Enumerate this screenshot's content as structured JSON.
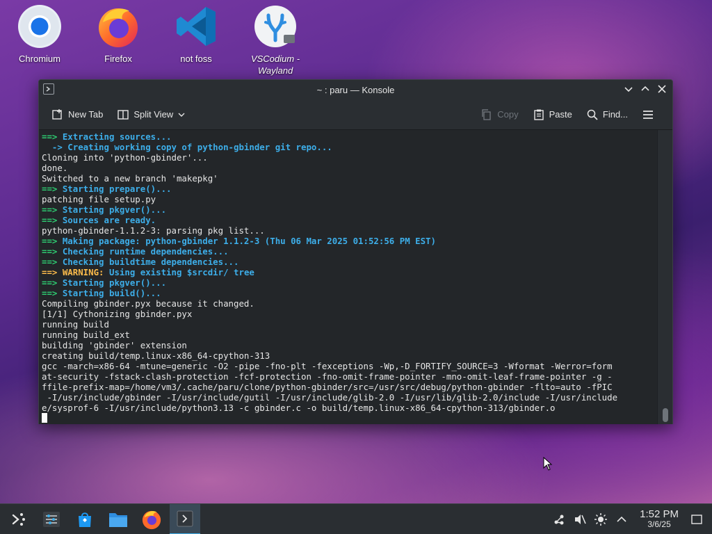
{
  "desktop": {
    "icons": [
      {
        "label": "Chromium"
      },
      {
        "label": "Firefox"
      },
      {
        "label": "not foss"
      },
      {
        "label": "VSCodium - Wayland"
      }
    ]
  },
  "window": {
    "title": "~ : paru — Konsole",
    "toolbar": {
      "new_tab": "New Tab",
      "split_view": "Split View",
      "copy": "Copy",
      "paste": "Paste",
      "find": "Find..."
    }
  },
  "terminal": {
    "lines": [
      [
        {
          "t": "==> ",
          "c": "c-green"
        },
        {
          "t": "Extracting sources...",
          "c": "c-blue"
        }
      ],
      [
        {
          "t": "  -> Creating working copy of python-gbinder git repo...",
          "c": "c-blue"
        }
      ],
      [
        {
          "t": "Cloning into 'python-gbinder'...",
          "c": ""
        }
      ],
      [
        {
          "t": "done.",
          "c": ""
        }
      ],
      [
        {
          "t": "Switched to a new branch 'makepkg'",
          "c": ""
        }
      ],
      [
        {
          "t": "==> ",
          "c": "c-green"
        },
        {
          "t": "Starting prepare()...",
          "c": "c-blue"
        }
      ],
      [
        {
          "t": "patching file setup.py",
          "c": ""
        }
      ],
      [
        {
          "t": "==> ",
          "c": "c-green"
        },
        {
          "t": "Starting pkgver()...",
          "c": "c-blue"
        }
      ],
      [
        {
          "t": "==> ",
          "c": "c-green"
        },
        {
          "t": "Sources are ready.",
          "c": "c-blue"
        }
      ],
      [
        {
          "t": "python-gbinder-1.1.2-3: parsing pkg list...",
          "c": ""
        }
      ],
      [
        {
          "t": "==> ",
          "c": "c-green"
        },
        {
          "t": "Making package: python-gbinder 1.1.2-3 (Thu 06 Mar 2025 01:52:56 PM EST)",
          "c": "c-blue"
        }
      ],
      [
        {
          "t": "==> ",
          "c": "c-green"
        },
        {
          "t": "Checking runtime dependencies...",
          "c": "c-blue"
        }
      ],
      [
        {
          "t": "==> ",
          "c": "c-green"
        },
        {
          "t": "Checking buildtime dependencies...",
          "c": "c-blue"
        }
      ],
      [
        {
          "t": "==> WARNING: ",
          "c": "c-yellow"
        },
        {
          "t": "Using existing $srcdir/ tree",
          "c": "c-blue"
        }
      ],
      [
        {
          "t": "==> ",
          "c": "c-green"
        },
        {
          "t": "Starting pkgver()...",
          "c": "c-blue"
        }
      ],
      [
        {
          "t": "==> ",
          "c": "c-green"
        },
        {
          "t": "Starting build()...",
          "c": "c-blue"
        }
      ],
      [
        {
          "t": "Compiling gbinder.pyx because it changed.",
          "c": ""
        }
      ],
      [
        {
          "t": "[1/1] Cythonizing gbinder.pyx",
          "c": ""
        }
      ],
      [
        {
          "t": "running build",
          "c": ""
        }
      ],
      [
        {
          "t": "running build_ext",
          "c": ""
        }
      ],
      [
        {
          "t": "building 'gbinder' extension",
          "c": ""
        }
      ],
      [
        {
          "t": "creating build/temp.linux-x86_64-cpython-313",
          "c": ""
        }
      ],
      [
        {
          "t": "gcc -march=x86-64 -mtune=generic -O2 -pipe -fno-plt -fexceptions -Wp,-D_FORTIFY_SOURCE=3 -Wformat -Werror=form",
          "c": ""
        }
      ],
      [
        {
          "t": "at-security -fstack-clash-protection -fcf-protection -fno-omit-frame-pointer -mno-omit-leaf-frame-pointer -g -",
          "c": ""
        }
      ],
      [
        {
          "t": "ffile-prefix-map=/home/vm3/.cache/paru/clone/python-gbinder/src=/usr/src/debug/python-gbinder -flto=auto -fPIC",
          "c": ""
        }
      ],
      [
        {
          "t": " -I/usr/include/gbinder -I/usr/include/gutil -I/usr/include/glib-2.0 -I/usr/lib/glib-2.0/include -I/usr/include",
          "c": ""
        }
      ],
      [
        {
          "t": "e/sysprof-6 -I/usr/include/python3.13 -c gbinder.c -o build/temp.linux-x86_64-cpython-313/gbinder.o",
          "c": ""
        }
      ]
    ]
  },
  "taskbar": {
    "clock_time": "1:52 PM",
    "clock_date": "3/6/25"
  }
}
